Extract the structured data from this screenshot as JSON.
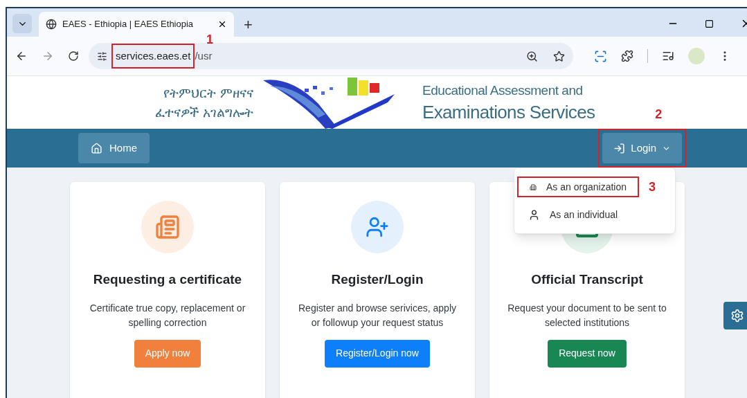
{
  "browser": {
    "tab_title": "EAES - Ethiopia | EAES Ethiopia",
    "new_tab": "+",
    "url": {
      "host": "services.eaes.et",
      "path": "/usr",
      "annotation": "1"
    }
  },
  "header": {
    "amharic_lines": [
      "የትምህርት ምዘናና",
      "ፈተናዎች አገልግሎት"
    ],
    "english_lines": [
      "Educational Assessment and",
      "Examinations Services"
    ]
  },
  "nav": {
    "home": "Home",
    "login": "Login",
    "login_annotation": "2"
  },
  "login_menu": {
    "expanded": true,
    "items": [
      {
        "label": "As an organization",
        "kind": "organization",
        "annotation": "3"
      },
      {
        "label": "As an individual",
        "kind": "individual"
      }
    ]
  },
  "cards": [
    {
      "kind": "certificate",
      "title": "Requesting a certificate",
      "description": "Certificate true copy, replacement or spelling correction",
      "button": "Apply now",
      "color": "#f0803c"
    },
    {
      "kind": "register",
      "title": "Register/Login",
      "description": "Register and browse serivices, apply or followup your request status",
      "button": "Register/Login now",
      "color": "#0d7ffb"
    },
    {
      "kind": "transcript",
      "title": "Official Transcript",
      "description": "Request your document to be sent to selected institutions",
      "button": "Request now",
      "color": "#198754"
    }
  ]
}
